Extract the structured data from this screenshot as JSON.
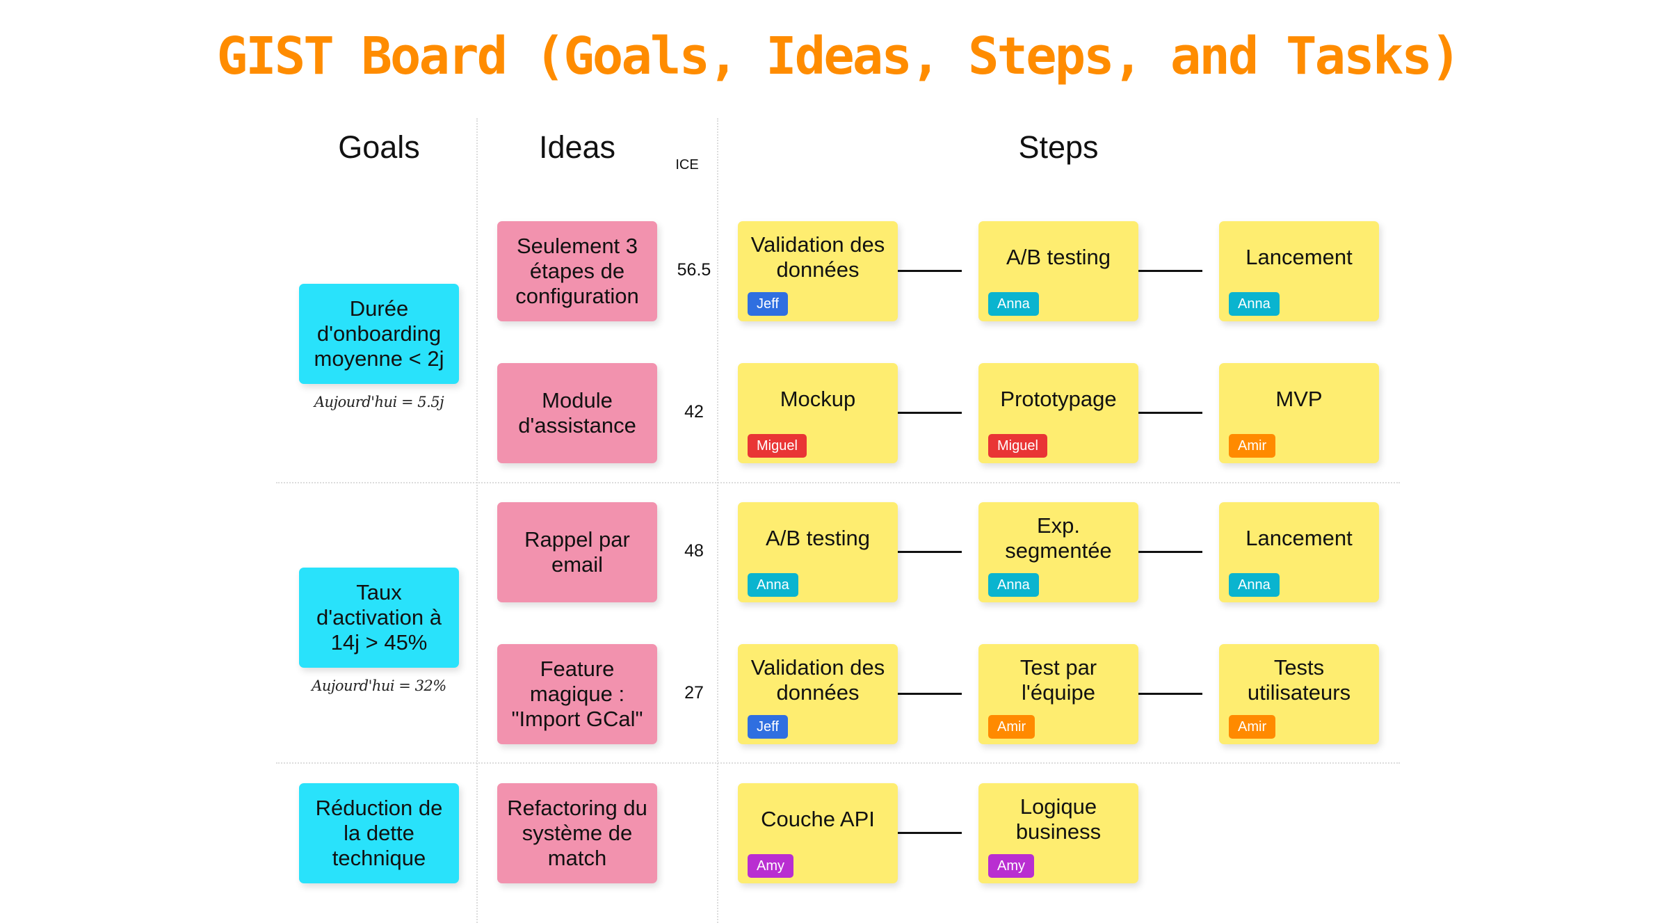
{
  "title": "GIST Board (Goals, Ideas, Steps, and Tasks)",
  "headers": {
    "goals": "Goals",
    "ideas": "Ideas",
    "ice": "ICE",
    "steps": "Steps"
  },
  "colors": {
    "title": "#FF8C00",
    "goal": "#29E2FB",
    "idea": "#F292AE",
    "step": "#FEED70",
    "assignees": {
      "Jeff": "#2F6FE0",
      "Anna": "#0AB4CF",
      "Miguel": "#E93535",
      "Amir": "#FF8A00",
      "Amy": "#B92ED1"
    }
  },
  "goals": [
    {
      "label": "Durée d'onboarding moyenne < 2j",
      "caption": "Aujourd'hui = 5.5j"
    },
    {
      "label": "Taux d'activation à 14j > 45%",
      "caption": "Aujourd'hui = 32%"
    },
    {
      "label": "Réduction de la dette technique",
      "caption": ""
    }
  ],
  "ideas": [
    {
      "goal": 0,
      "label": "Seulement 3 étapes de configuration",
      "ice": "56.5",
      "steps": [
        {
          "label": "Validation des données",
          "assignee": "Jeff"
        },
        {
          "label": "A/B testing",
          "assignee": "Anna"
        },
        {
          "label": "Lancement",
          "assignee": "Anna"
        }
      ]
    },
    {
      "goal": 0,
      "label": "Module d'assistance",
      "ice": "42",
      "steps": [
        {
          "label": "Mockup",
          "assignee": "Miguel"
        },
        {
          "label": "Prototypage",
          "assignee": "Miguel"
        },
        {
          "label": "MVP",
          "assignee": "Amir"
        }
      ]
    },
    {
      "goal": 1,
      "label": "Rappel par email",
      "ice": "48",
      "steps": [
        {
          "label": "A/B testing",
          "assignee": "Anna"
        },
        {
          "label": "Exp. segmentée",
          "assignee": "Anna"
        },
        {
          "label": "Lancement",
          "assignee": "Anna"
        }
      ]
    },
    {
      "goal": 1,
      "label": "Feature magique : \"Import GCal\"",
      "ice": "27",
      "steps": [
        {
          "label": "Validation des données",
          "assignee": "Jeff"
        },
        {
          "label": "Test par l'équipe",
          "assignee": "Amir"
        },
        {
          "label": "Tests utilisateurs",
          "assignee": "Amir"
        }
      ]
    },
    {
      "goal": 2,
      "label": "Refactoring du système de match",
      "ice": "",
      "steps": [
        {
          "label": "Couche API",
          "assignee": "Amy"
        },
        {
          "label": "Logique business",
          "assignee": "Amy"
        }
      ]
    }
  ]
}
